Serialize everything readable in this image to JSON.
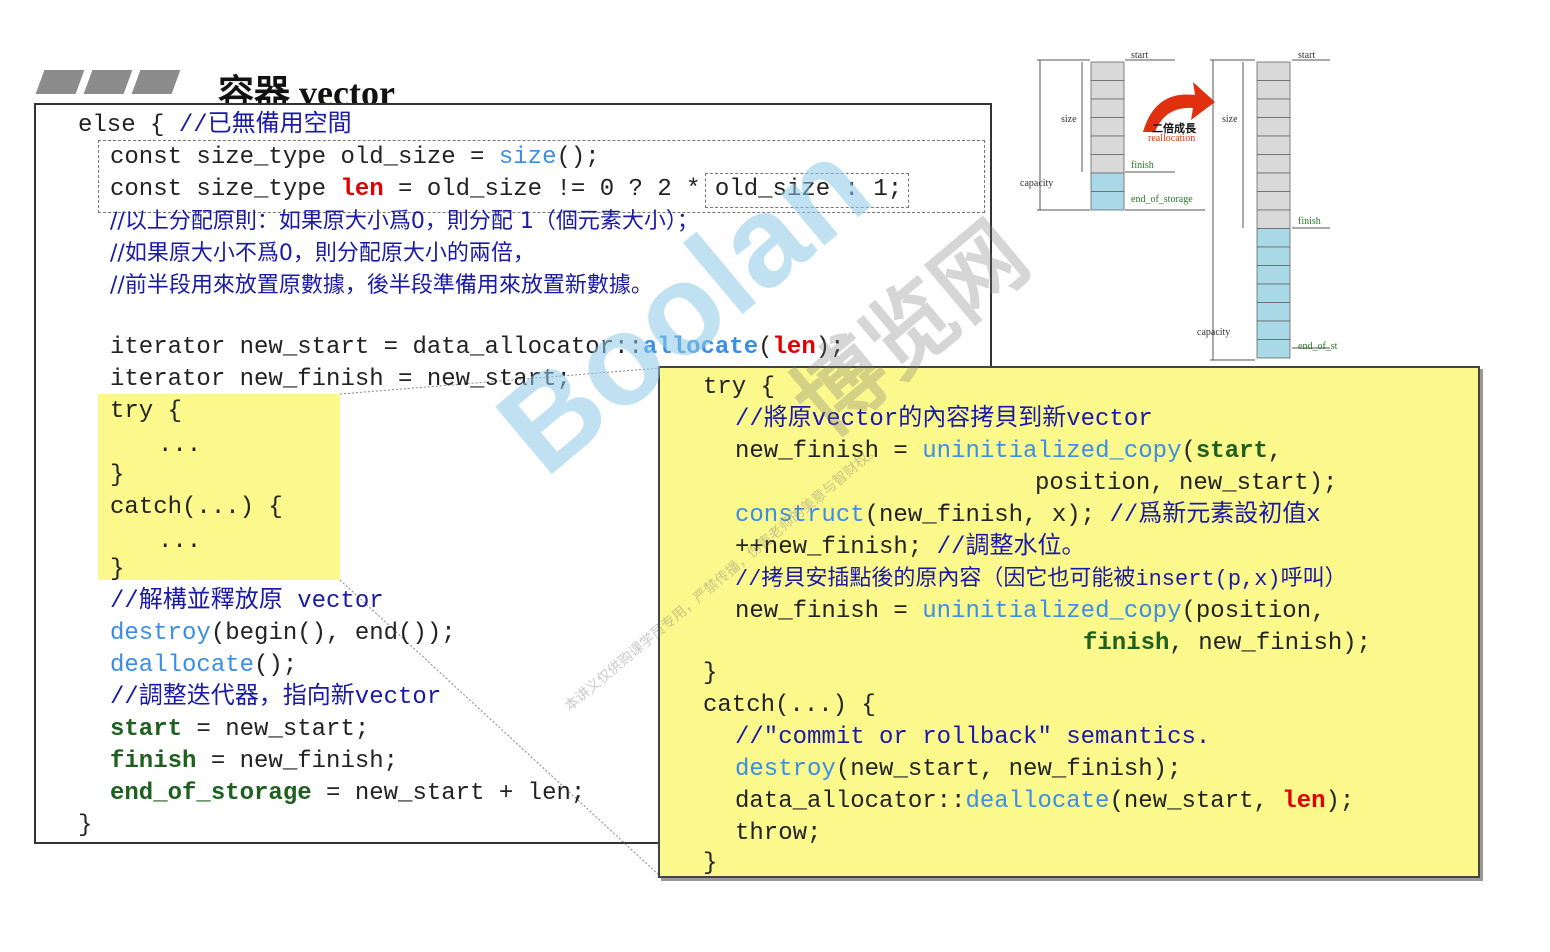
{
  "title": "容器 vector",
  "main_code": {
    "l1_a": "else { ",
    "l1_b": "//已無備用空間",
    "l2_a": "const size_type old_size = ",
    "l2_b": "size",
    "l2_c": "();",
    "l3_a": "const size_type ",
    "l3_b": "len",
    "l3_c": " = old_size != 0 ? ",
    "l3_d": "2 * old_size",
    "l3_e": " : 1;",
    "c1": "//以上分配原則：如果原大小爲0，則分配 1（個元素大小）；",
    "c2": "//如果原大小不爲0，則分配原大小的兩倍，",
    "c3": "//前半段用來放置原數據，後半段準備用來放置新數據。",
    "it1_a": "iterator new_start = data_allocator::",
    "it1_b": "allocate",
    "it1_c": "(",
    "it1_d": "len",
    "it1_e": ");",
    "it2": "iterator new_finish = new_start;",
    "try": "try {",
    "dots1": "...",
    "close1": "}",
    "catch": "catch(...) {",
    "dots2": "...",
    "close2": "}",
    "c4": "//解構並釋放原 vector",
    "d1_a": "destroy",
    "d1_b": "(begin(), end());",
    "d2_a": "deallocate",
    "d2_b": "();",
    "c5": "//調整迭代器，指向新vector",
    "s1_a": "start",
    "s1_b": " = new_start;",
    "s2_a": "finish",
    "s2_b": " = new_finish;",
    "s3_a": "end_of_storage",
    "s3_b": " = new_start + len;",
    "end": "}"
  },
  "popup_code": {
    "p1": "try {",
    "p2": "//將原vector的內容拷貝到新vector",
    "p3_a": "new_finish = ",
    "p3_b": "uninitialized_copy",
    "p3_c": "(",
    "p3_d": "start",
    "p3_e": ",",
    "p4": "position, new_start);",
    "p5_a": "construct",
    "p5_b": "(new_finish, x); ",
    "p5_c": "//爲新元素設初值x",
    "p6_a": "++new_finish; ",
    "p6_b": "//調整水位。",
    "p7": "//拷貝安插點後的原內容（因它也可能被insert(p,x)呼叫）",
    "p8_a": "new_finish = ",
    "p8_b": "uninitialized_copy",
    "p8_c": "(position,",
    "p9_a": "finish",
    "p9_b": ", new_finish);",
    "p10": "}",
    "p11": "catch(...) {",
    "p12": "//\"commit or rollback\" semantics.",
    "p13_a": "destroy",
    "p13_b": "(new_start, new_finish);",
    "p14_a": "data_allocator::",
    "p14_b": "deallocate",
    "p14_c": "(new_start, ",
    "p14_d": "len",
    "p14_e": ");",
    "p15": "throw;",
    "p16": "}"
  },
  "diagram": {
    "start_label": "start",
    "start_label2": "start",
    "size_label": "size",
    "size_label2": "size",
    "capacity_label": "capacity",
    "capacity_label2": "capacity",
    "finish_label": "finish",
    "finish_label2": "finish",
    "eos_label": "end_of_storage",
    "eos_label2": "end_of_st",
    "arrow_text": "二倍成長",
    "arrow_sub": "reallocation",
    "used_color": "#d9d9d9",
    "free_color": "#a9d8e6",
    "arrow_color": "#e03010"
  },
  "watermark": {
    "brand": "Boolan",
    "cn": "博览网",
    "note": "本讲义仅供购课学员专用，严禁传播，伤害老师的美意与智财权。"
  }
}
